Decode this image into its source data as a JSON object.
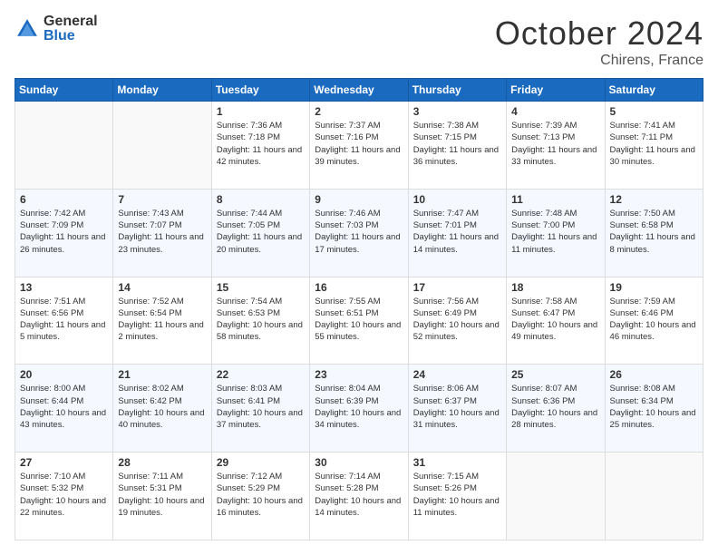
{
  "header": {
    "logo_general": "General",
    "logo_blue": "Blue",
    "month": "October 2024",
    "location": "Chirens, France"
  },
  "weekdays": [
    "Sunday",
    "Monday",
    "Tuesday",
    "Wednesday",
    "Thursday",
    "Friday",
    "Saturday"
  ],
  "rows": [
    [
      {
        "day": "",
        "empty": true
      },
      {
        "day": "",
        "empty": true
      },
      {
        "day": "1",
        "sunrise": "7:36 AM",
        "sunset": "7:18 PM",
        "daylight": "11 hours and 42 minutes."
      },
      {
        "day": "2",
        "sunrise": "7:37 AM",
        "sunset": "7:16 PM",
        "daylight": "11 hours and 39 minutes."
      },
      {
        "day": "3",
        "sunrise": "7:38 AM",
        "sunset": "7:15 PM",
        "daylight": "11 hours and 36 minutes."
      },
      {
        "day": "4",
        "sunrise": "7:39 AM",
        "sunset": "7:13 PM",
        "daylight": "11 hours and 33 minutes."
      },
      {
        "day": "5",
        "sunrise": "7:41 AM",
        "sunset": "7:11 PM",
        "daylight": "11 hours and 30 minutes."
      }
    ],
    [
      {
        "day": "6",
        "sunrise": "7:42 AM",
        "sunset": "7:09 PM",
        "daylight": "11 hours and 26 minutes."
      },
      {
        "day": "7",
        "sunrise": "7:43 AM",
        "sunset": "7:07 PM",
        "daylight": "11 hours and 23 minutes."
      },
      {
        "day": "8",
        "sunrise": "7:44 AM",
        "sunset": "7:05 PM",
        "daylight": "11 hours and 20 minutes."
      },
      {
        "day": "9",
        "sunrise": "7:46 AM",
        "sunset": "7:03 PM",
        "daylight": "11 hours and 17 minutes."
      },
      {
        "day": "10",
        "sunrise": "7:47 AM",
        "sunset": "7:01 PM",
        "daylight": "11 hours and 14 minutes."
      },
      {
        "day": "11",
        "sunrise": "7:48 AM",
        "sunset": "7:00 PM",
        "daylight": "11 hours and 11 minutes."
      },
      {
        "day": "12",
        "sunrise": "7:50 AM",
        "sunset": "6:58 PM",
        "daylight": "11 hours and 8 minutes."
      }
    ],
    [
      {
        "day": "13",
        "sunrise": "7:51 AM",
        "sunset": "6:56 PM",
        "daylight": "11 hours and 5 minutes."
      },
      {
        "day": "14",
        "sunrise": "7:52 AM",
        "sunset": "6:54 PM",
        "daylight": "11 hours and 2 minutes."
      },
      {
        "day": "15",
        "sunrise": "7:54 AM",
        "sunset": "6:53 PM",
        "daylight": "10 hours and 58 minutes."
      },
      {
        "day": "16",
        "sunrise": "7:55 AM",
        "sunset": "6:51 PM",
        "daylight": "10 hours and 55 minutes."
      },
      {
        "day": "17",
        "sunrise": "7:56 AM",
        "sunset": "6:49 PM",
        "daylight": "10 hours and 52 minutes."
      },
      {
        "day": "18",
        "sunrise": "7:58 AM",
        "sunset": "6:47 PM",
        "daylight": "10 hours and 49 minutes."
      },
      {
        "day": "19",
        "sunrise": "7:59 AM",
        "sunset": "6:46 PM",
        "daylight": "10 hours and 46 minutes."
      }
    ],
    [
      {
        "day": "20",
        "sunrise": "8:00 AM",
        "sunset": "6:44 PM",
        "daylight": "10 hours and 43 minutes."
      },
      {
        "day": "21",
        "sunrise": "8:02 AM",
        "sunset": "6:42 PM",
        "daylight": "10 hours and 40 minutes."
      },
      {
        "day": "22",
        "sunrise": "8:03 AM",
        "sunset": "6:41 PM",
        "daylight": "10 hours and 37 minutes."
      },
      {
        "day": "23",
        "sunrise": "8:04 AM",
        "sunset": "6:39 PM",
        "daylight": "10 hours and 34 minutes."
      },
      {
        "day": "24",
        "sunrise": "8:06 AM",
        "sunset": "6:37 PM",
        "daylight": "10 hours and 31 minutes."
      },
      {
        "day": "25",
        "sunrise": "8:07 AM",
        "sunset": "6:36 PM",
        "daylight": "10 hours and 28 minutes."
      },
      {
        "day": "26",
        "sunrise": "8:08 AM",
        "sunset": "6:34 PM",
        "daylight": "10 hours and 25 minutes."
      }
    ],
    [
      {
        "day": "27",
        "sunrise": "7:10 AM",
        "sunset": "5:32 PM",
        "daylight": "10 hours and 22 minutes."
      },
      {
        "day": "28",
        "sunrise": "7:11 AM",
        "sunset": "5:31 PM",
        "daylight": "10 hours and 19 minutes."
      },
      {
        "day": "29",
        "sunrise": "7:12 AM",
        "sunset": "5:29 PM",
        "daylight": "10 hours and 16 minutes."
      },
      {
        "day": "30",
        "sunrise": "7:14 AM",
        "sunset": "5:28 PM",
        "daylight": "10 hours and 14 minutes."
      },
      {
        "day": "31",
        "sunrise": "7:15 AM",
        "sunset": "5:26 PM",
        "daylight": "10 hours and 11 minutes."
      },
      {
        "day": "",
        "empty": true
      },
      {
        "day": "",
        "empty": true
      }
    ]
  ]
}
